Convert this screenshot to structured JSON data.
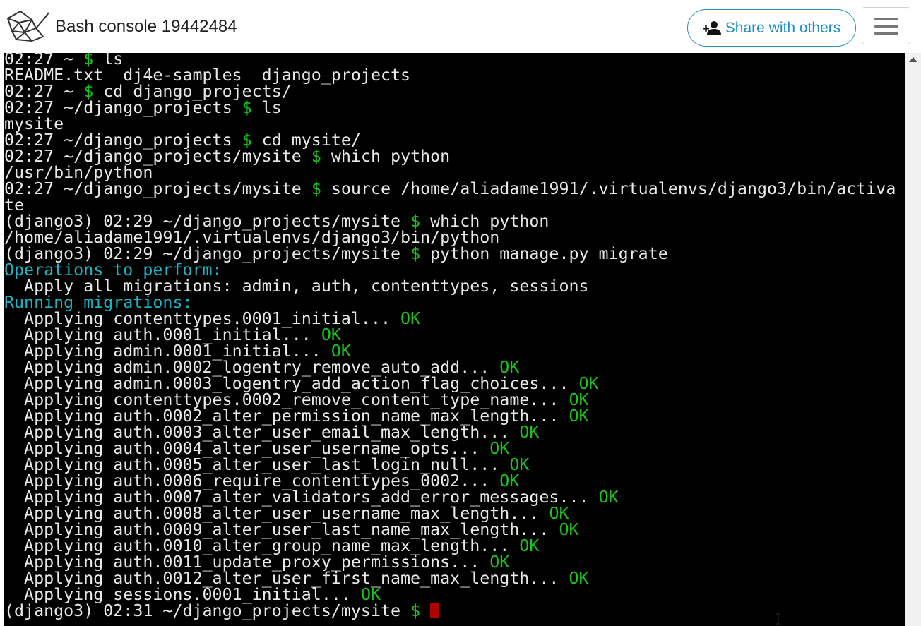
{
  "header": {
    "console_title": "Bash console 19442484",
    "share_label": "Share with others"
  },
  "icons": {
    "logo": "pythonanywhere-logo-icon",
    "share": "add-user-icon",
    "menu": "hamburger-menu-icon",
    "cursor": "text-ibeam-icon"
  },
  "colors": {
    "terminal_bg": "#000000",
    "terminal_text": "#e8e8e8",
    "prompt_green": "#19c419",
    "cyan": "#19b5c4",
    "cursor_red": "#b30000",
    "accent_blue": "#1c8fc0"
  },
  "terminal": {
    "lines": [
      [
        {
          "t": "02:27 ~ "
        },
        {
          "t": "$",
          "c": "g"
        },
        {
          "t": " ls"
        }
      ],
      [
        {
          "t": "README.txt  dj4e-samples  django_projects"
        }
      ],
      [
        {
          "t": "02:27 ~ "
        },
        {
          "t": "$",
          "c": "g"
        },
        {
          "t": " cd django_projects/"
        }
      ],
      [
        {
          "t": "02:27 ~/django_projects "
        },
        {
          "t": "$",
          "c": "g"
        },
        {
          "t": " ls"
        }
      ],
      [
        {
          "t": "mysite"
        }
      ],
      [
        {
          "t": "02:27 ~/django_projects "
        },
        {
          "t": "$",
          "c": "g"
        },
        {
          "t": " cd mysite/"
        }
      ],
      [
        {
          "t": "02:27 ~/django_projects/mysite "
        },
        {
          "t": "$",
          "c": "g"
        },
        {
          "t": " which python"
        }
      ],
      [
        {
          "t": "/usr/bin/python"
        }
      ],
      [
        {
          "t": "02:27 ~/django_projects/mysite "
        },
        {
          "t": "$",
          "c": "g"
        },
        {
          "t": " source /home/aliadame1991/.virtualenvs/django3/bin/activa"
        }
      ],
      [
        {
          "t": "te"
        }
      ],
      [
        {
          "t": "(django3) 02:29 ~/django_projects/mysite "
        },
        {
          "t": "$",
          "c": "g"
        },
        {
          "t": " which python"
        }
      ],
      [
        {
          "t": "/home/aliadame1991/.virtualenvs/django3/bin/python"
        }
      ],
      [
        {
          "t": "(django3) 02:29 ~/django_projects/mysite "
        },
        {
          "t": "$",
          "c": "g"
        },
        {
          "t": " python manage.py migrate"
        }
      ],
      [
        {
          "t": "Operations to perform:",
          "c": "c"
        }
      ],
      [
        {
          "t": "  Apply all migrations: admin, auth, contenttypes, sessions"
        }
      ],
      [
        {
          "t": "Running migrations:",
          "c": "c"
        }
      ],
      [
        {
          "t": "  Applying contenttypes.0001_initial... "
        },
        {
          "t": "OK",
          "c": "g"
        }
      ],
      [
        {
          "t": "  Applying auth.0001_initial... "
        },
        {
          "t": "OK",
          "c": "g"
        }
      ],
      [
        {
          "t": "  Applying admin.0001_initial... "
        },
        {
          "t": "OK",
          "c": "g"
        }
      ],
      [
        {
          "t": "  Applying admin.0002_logentry_remove_auto_add... "
        },
        {
          "t": "OK",
          "c": "g"
        }
      ],
      [
        {
          "t": "  Applying admin.0003_logentry_add_action_flag_choices... "
        },
        {
          "t": "OK",
          "c": "g"
        }
      ],
      [
        {
          "t": "  Applying contenttypes.0002_remove_content_type_name... "
        },
        {
          "t": "OK",
          "c": "g"
        }
      ],
      [
        {
          "t": "  Applying auth.0002_alter_permission_name_max_length... "
        },
        {
          "t": "OK",
          "c": "g"
        }
      ],
      [
        {
          "t": "  Applying auth.0003_alter_user_email_max_length... "
        },
        {
          "t": "OK",
          "c": "g"
        }
      ],
      [
        {
          "t": "  Applying auth.0004_alter_user_username_opts... "
        },
        {
          "t": "OK",
          "c": "g"
        }
      ],
      [
        {
          "t": "  Applying auth.0005_alter_user_last_login_null... "
        },
        {
          "t": "OK",
          "c": "g"
        }
      ],
      [
        {
          "t": "  Applying auth.0006_require_contenttypes_0002... "
        },
        {
          "t": "OK",
          "c": "g"
        }
      ],
      [
        {
          "t": "  Applying auth.0007_alter_validators_add_error_messages... "
        },
        {
          "t": "OK",
          "c": "g"
        }
      ],
      [
        {
          "t": "  Applying auth.0008_alter_user_username_max_length... "
        },
        {
          "t": "OK",
          "c": "g"
        }
      ],
      [
        {
          "t": "  Applying auth.0009_alter_user_last_name_max_length... "
        },
        {
          "t": "OK",
          "c": "g"
        }
      ],
      [
        {
          "t": "  Applying auth.0010_alter_group_name_max_length... "
        },
        {
          "t": "OK",
          "c": "g"
        }
      ],
      [
        {
          "t": "  Applying auth.0011_update_proxy_permissions... "
        },
        {
          "t": "OK",
          "c": "g"
        }
      ],
      [
        {
          "t": "  Applying auth.0012_alter_user_first_name_max_length... "
        },
        {
          "t": "OK",
          "c": "g"
        }
      ],
      [
        {
          "t": "  Applying sessions.0001_initial... "
        },
        {
          "t": "OK",
          "c": "g"
        }
      ],
      [
        {
          "t": "(django3) 02:31 ~/django_projects/mysite "
        },
        {
          "t": "$",
          "c": "g"
        },
        {
          "t": " "
        },
        {
          "cursor": true
        }
      ]
    ]
  }
}
